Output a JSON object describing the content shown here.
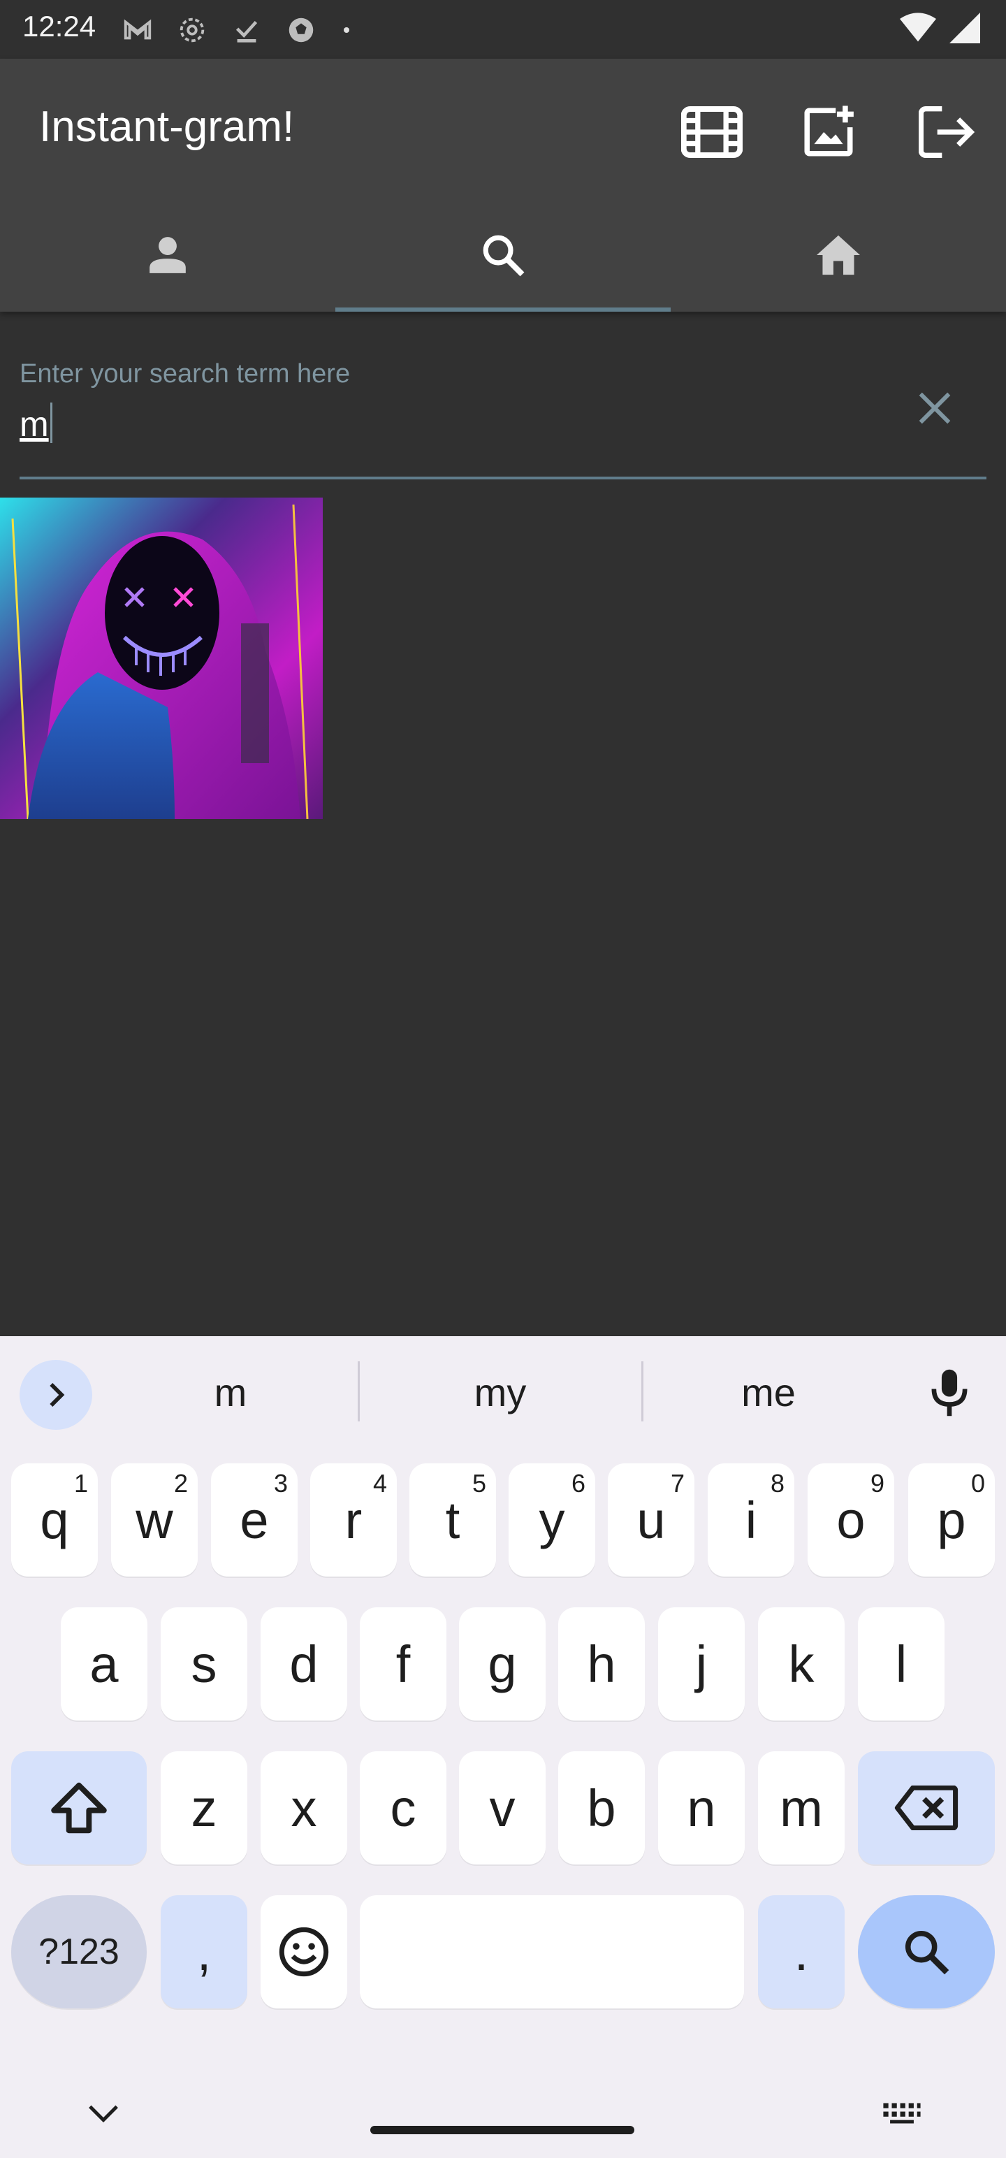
{
  "status_bar": {
    "time": "12:24",
    "notification_icons": [
      "gmail-icon",
      "settings-icon",
      "download-done-icon",
      "soccer-icon",
      "dot-icon"
    ],
    "system_icons": [
      "wifi-icon",
      "signal-icon"
    ]
  },
  "app_bar": {
    "title": "Instant-gram!",
    "actions": [
      "movie-icon",
      "add-photo-icon",
      "logout-icon"
    ]
  },
  "tabs": [
    {
      "icon": "person-icon",
      "active": false
    },
    {
      "icon": "search-icon",
      "active": true
    },
    {
      "icon": "home-icon",
      "active": false
    }
  ],
  "search": {
    "hint": "Enter your search term here",
    "value": "m"
  },
  "results": [
    {
      "description": "hooded figure with neon mask"
    }
  ],
  "keyboard": {
    "suggestions": [
      "m",
      "my",
      "me"
    ],
    "row1": [
      {
        "key": "q",
        "num": "1"
      },
      {
        "key": "w",
        "num": "2"
      },
      {
        "key": "e",
        "num": "3"
      },
      {
        "key": "r",
        "num": "4"
      },
      {
        "key": "t",
        "num": "5"
      },
      {
        "key": "y",
        "num": "6"
      },
      {
        "key": "u",
        "num": "7"
      },
      {
        "key": "i",
        "num": "8"
      },
      {
        "key": "o",
        "num": "9"
      },
      {
        "key": "p",
        "num": "0"
      }
    ],
    "row2": [
      "a",
      "s",
      "d",
      "f",
      "g",
      "h",
      "j",
      "k",
      "l"
    ],
    "row3": [
      "z",
      "x",
      "c",
      "v",
      "b",
      "n",
      "m"
    ],
    "symbols_label": "?123",
    "comma": ",",
    "period": "."
  },
  "colors": {
    "background": "#303030",
    "app_bar": "#424242",
    "accent": "#607d8b",
    "keyboard_bg": "#f1eef4",
    "search_key": "#a9c6fb"
  }
}
